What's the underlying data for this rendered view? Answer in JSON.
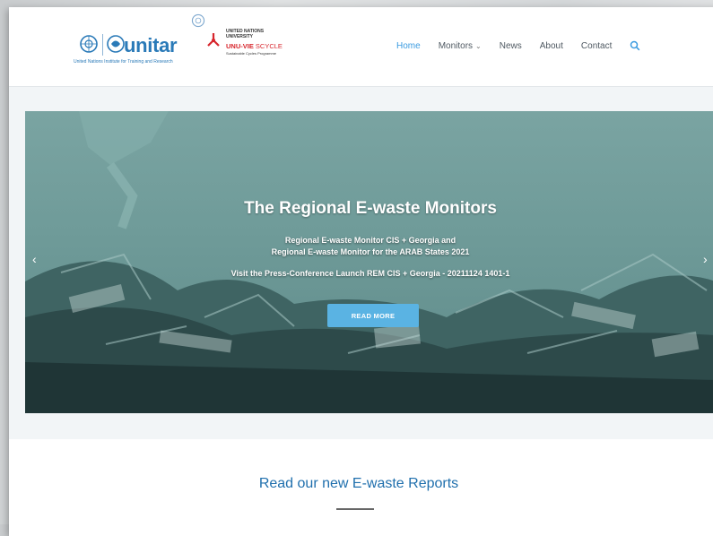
{
  "header": {
    "logo_unitar": {
      "wordmark": "unitar",
      "subtitle": "United Nations Institute for Training and Research"
    },
    "logo_unu": {
      "line1": "UNITED NATIONS",
      "line2": "UNIVERSITY",
      "title_bold": "UNU-VIE",
      "title_light": " SCYCLE",
      "subtitle": "Sustainable Cycles Programme"
    },
    "nav": {
      "home": "Home",
      "monitors": "Monitors",
      "news": "News",
      "about": "About",
      "contact": "Contact"
    }
  },
  "hero": {
    "title": "The Regional E-waste Monitors",
    "line1": "Regional E-waste Monitor CIS + Georgia and",
    "line2": "Regional E-waste Monitor for the ARAB States 2021",
    "line3": "Visit the Press-Conference Launch REM CIS + Georgia - 20211124 1401-1",
    "button": "READ MORE"
  },
  "reports": {
    "title": "Read our new E-waste Reports"
  },
  "colors": {
    "accent": "#3a9be0",
    "button": "#5ab3e3",
    "reports_title": "#1f6fad",
    "hero_tint": "#6f9b99"
  }
}
